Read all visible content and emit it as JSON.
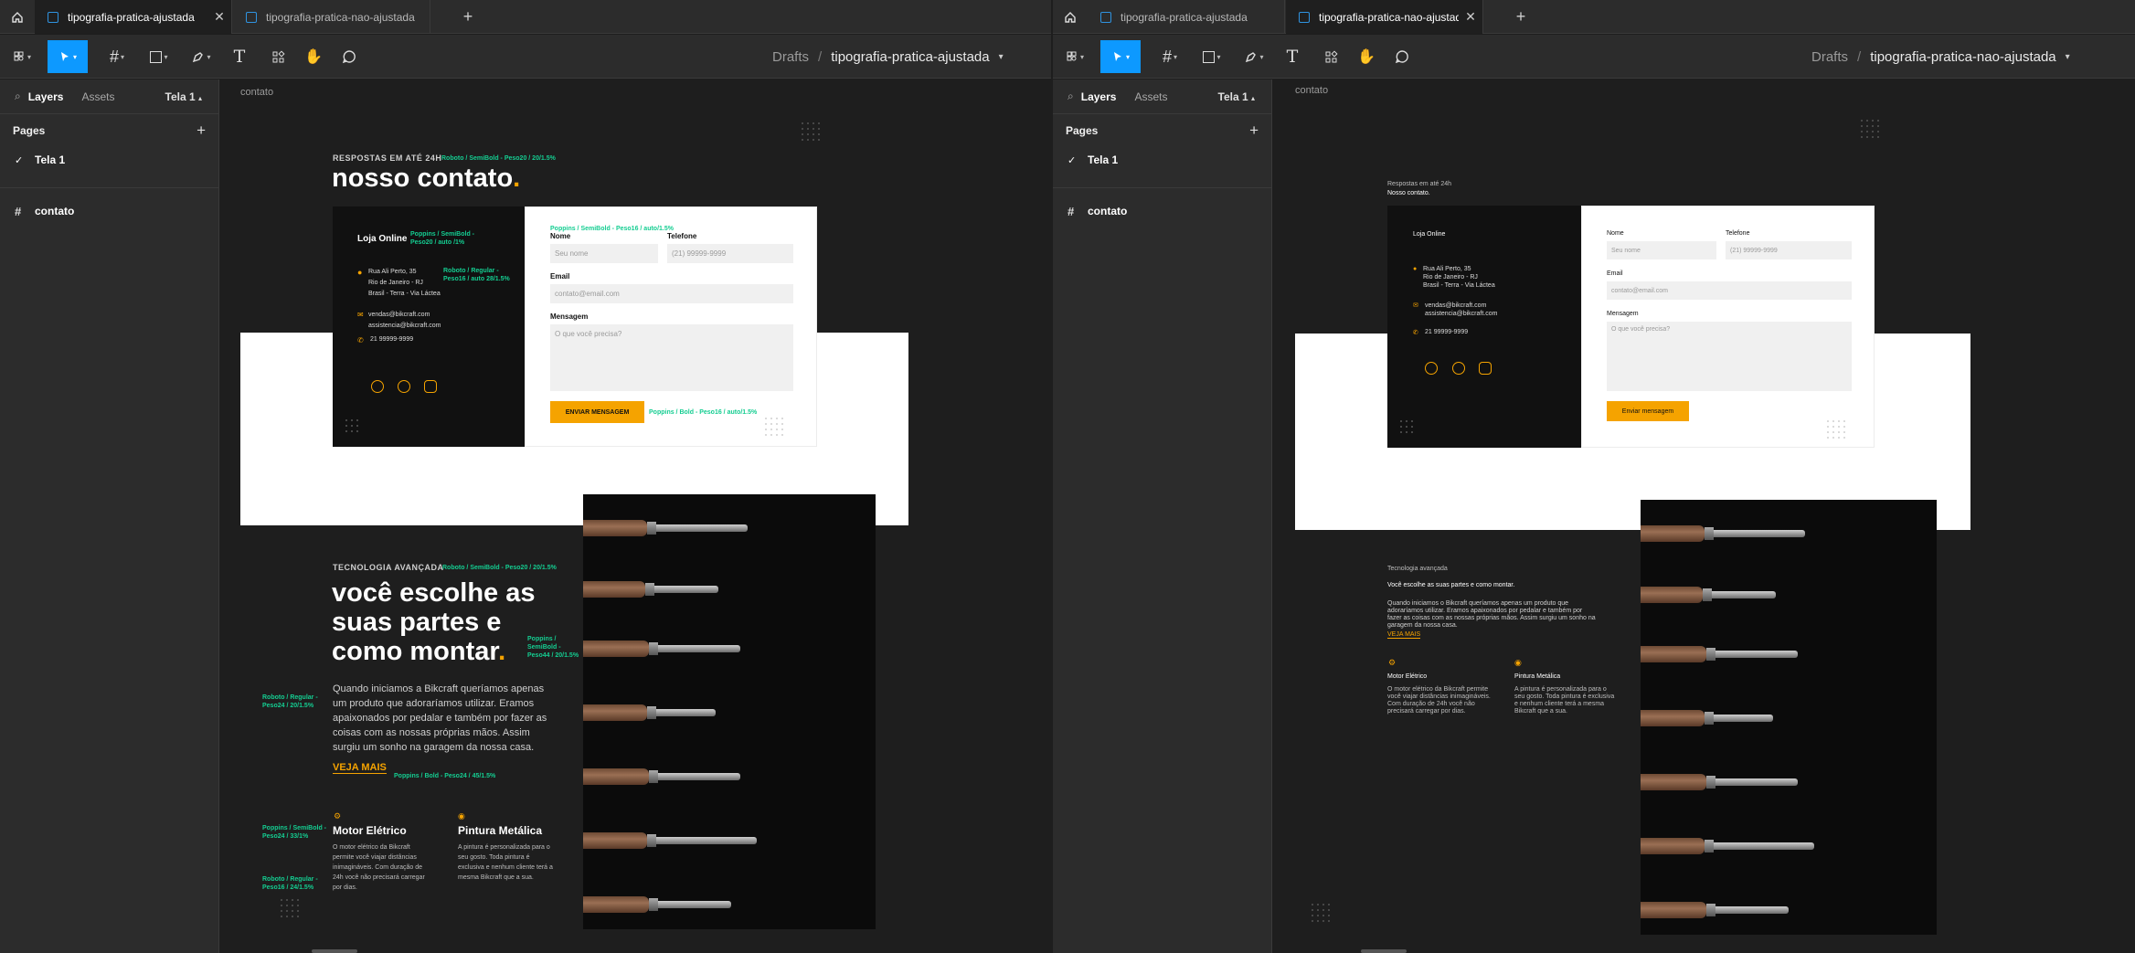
{
  "left": {
    "tabs": [
      {
        "label": "tipografia-pratica-ajustada",
        "active": true
      },
      {
        "label": "tipografia-pratica-nao-ajustada",
        "active": false
      }
    ],
    "breadcrumb": {
      "root": "Drafts",
      "sep": "/",
      "file": "tipografia-pratica-ajustada"
    },
    "sidebar": {
      "layers": "Layers",
      "assets": "Assets",
      "page_picker": "Tela 1",
      "pages_title": "Pages",
      "page": "Tela 1",
      "layer": "contato"
    },
    "frame_label": "contato",
    "design": {
      "eyebrow": "RESPOSTAS EM ATÉ 24H",
      "heading": "nosso contato",
      "heading_dot": ".",
      "ann_eyebrow": "Roboto / SemiBold - Peso20 / 20/1.5%",
      "ann_loja": [
        "Poppins / SemiBold -",
        "Peso20 / auto /1%"
      ],
      "ann_addr": [
        "Roboto / Regular -",
        "Peso16 / auto 28/1.5%"
      ],
      "ann_form": "Poppins / SemiBold - Peso16 / auto/1.5%",
      "ann_btn": "Poppins / Bold - Peso16 / auto/1.5%",
      "loja": "Loja Online",
      "addr": [
        "Rua Ali Perto, 35",
        "Rio de Janeiro - RJ",
        "Brasil - Terra - Via Láctea"
      ],
      "emails": [
        "vendas@bikcraft.com",
        "assistencia@bikcraft.com"
      ],
      "phone": "21 99999-9999",
      "f_nome": "Nome",
      "f_nome_ph": "Seu nome",
      "f_tel": "Telefone",
      "f_tel_ph": "(21) 99999-9999",
      "f_email": "Email",
      "f_email_ph": "contato@email.com",
      "f_msg": "Mensagem",
      "f_msg_ph": "O que você precisa?",
      "btn": "ENVIAR MENSAGEM",
      "eyebrow2": "TECNOLOGIA AVANÇADA",
      "ann_eyebrow2": "Roboto / SemiBold - Peso20 / 20/1.5%",
      "h2": [
        "você escolhe as",
        "suas partes e",
        "como montar"
      ],
      "h2_dot": ".",
      "ann_h2": [
        "Poppins /",
        "SemiBold -",
        "Peso44 / 20/1.5%"
      ],
      "ann_p": [
        "Roboto / Regular -",
        "Peso24 / 20/1.5%"
      ],
      "para": [
        "Quando iniciamos a Bikcraft queríamos apenas",
        "um produto que adoraríamos utilizar. Eramos",
        "apaixonados por pedalar e também por fazer as",
        "coisas com as nossas próprias mãos. Assim",
        "surgiu um sonho na garagem da nossa casa."
      ],
      "link": "VEJA MAIS",
      "ann_link": "Poppins / Bold - Peso24 / 45/1.5%",
      "ann_feat_t": [
        "Poppins / SemiBold -",
        "Peso24 / 33/1%"
      ],
      "ann_feat_p": [
        "Roboto / Regular -",
        "Peso16 / 24/1.5%"
      ],
      "feat1_t": "Motor Elétrico",
      "feat1_p": [
        "O motor elétrico da Bikcraft",
        "permite você viajar distâncias",
        "inimagináveis. Com duração de",
        "24h você não precisará carregar",
        "por dias."
      ],
      "feat2_t": "Pintura Metálica",
      "feat2_p": [
        "A pintura é personalizada para o",
        "seu gosto. Toda pintura é",
        "exclusiva e nenhum cliente terá a",
        "mesma Bikcraft que a sua."
      ]
    }
  },
  "right": {
    "tabs": [
      {
        "label": "tipografia-pratica-ajustada",
        "active": false
      },
      {
        "label": "tipografia-pratica-nao-ajustada",
        "active": true
      }
    ],
    "breadcrumb": {
      "root": "Drafts",
      "sep": "/",
      "file": "tipografia-pratica-nao-ajustada"
    },
    "sidebar": {
      "layers": "Layers",
      "assets": "Assets",
      "page_picker": "Tela 1",
      "pages_title": "Pages",
      "page": "Tela 1",
      "layer": "contato"
    },
    "frame_label": "contato",
    "design": {
      "eyebrow": "Respostas em até 24h",
      "heading": "Nosso contato.",
      "loja": "Loja Online",
      "addr": [
        "Rua Ali Perto, 35",
        "Rio de Janeiro - RJ",
        "Brasil - Terra - Via Láctea"
      ],
      "emails": [
        "vendas@bikcraft.com",
        "assistencia@bikcraft.com"
      ],
      "phone": "21 99999-9999",
      "f_nome": "Nome",
      "f_nome_ph": "Seu nome",
      "f_tel": "Telefone",
      "f_tel_ph": "(21) 99999-9999",
      "f_email": "Email",
      "f_email_ph": "contato@email.com",
      "f_msg": "Mensagem",
      "f_msg_ph": "O que você precisa?",
      "btn": "Enviar mensagem",
      "eyebrow2": "Tecnologia avançada",
      "h2": "Você escolhe as suas partes e como montar.",
      "para": [
        "Quando iniciamos o Bikcraft queríamos apenas um produto que",
        "adoraríamos utilizar. Eramos apaixonados por pedalar e também por",
        "fazer as coisas com as nossas próprias mãos. Assim surgiu um sonho na",
        "garagem da nossa casa."
      ],
      "link": "VEJA MAIS",
      "feat1_t": "Motor Elétrico",
      "feat1_p": [
        "O motor elétrico da Bikcraft permite",
        "você viajar distâncias inimagináveis.",
        "Com duração de 24h você não",
        "precisará carregar por dias."
      ],
      "feat2_t": "Pintura Metálica",
      "feat2_p": [
        "A pintura é personalizada para o",
        "seu gosto. Toda pintura é exclusiva",
        "e nenhum cliente terá a mesma",
        "Bikcraft que a sua."
      ]
    }
  },
  "colors": {
    "accent": "#f5a300",
    "annotation": "#14cd91",
    "figma_blue": "#0d99ff"
  }
}
